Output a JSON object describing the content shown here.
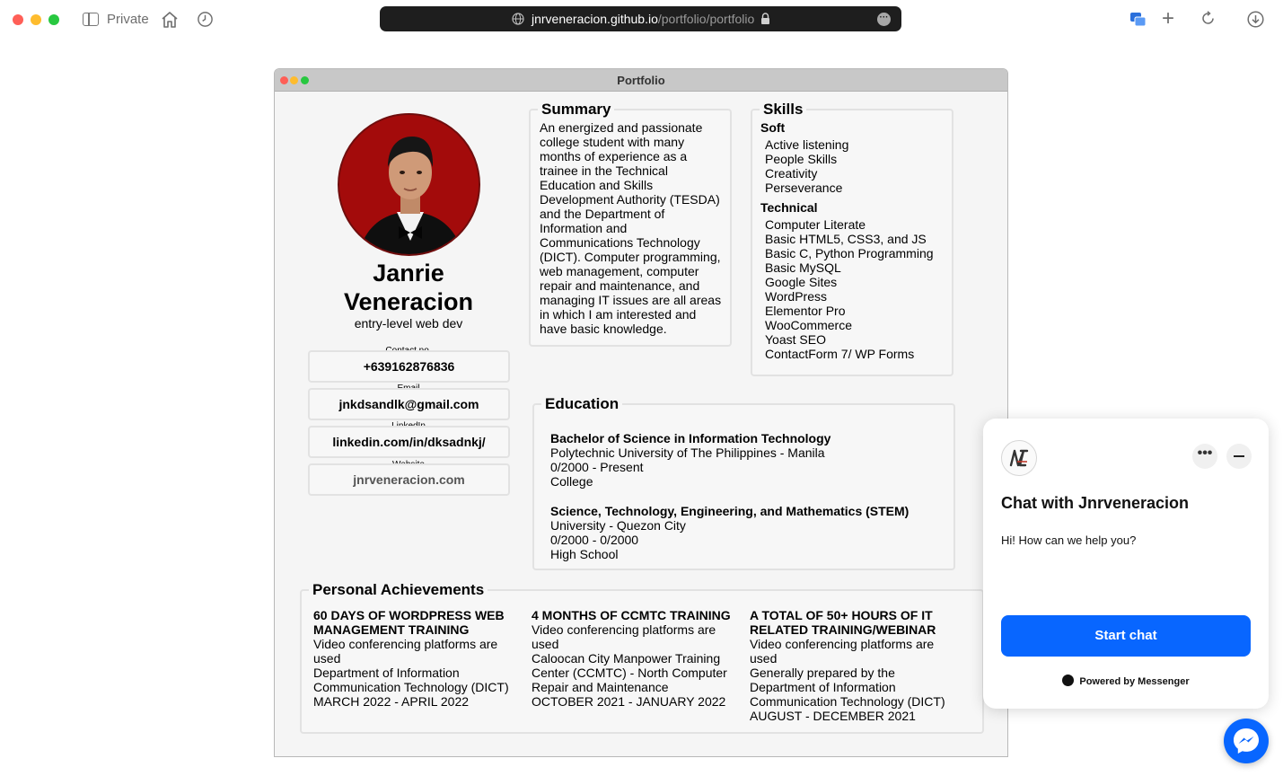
{
  "browser": {
    "private_label": "Private",
    "url_host": "jnrveneracion.github.io",
    "url_path": "/portfolio/portfolio"
  },
  "window": {
    "title": "Portfolio"
  },
  "profile": {
    "name": "Janrie Veneracion",
    "role": "entry-level web dev",
    "contacts": [
      {
        "label": "Contact no.",
        "value": "+639162876836"
      },
      {
        "label": "Email",
        "value": "jnkdsandlk@gmail.com"
      },
      {
        "label": "LinkedIn",
        "value": "linkedin.com/in/dksadnkj/"
      },
      {
        "label": "Website",
        "value": "jnrveneracion.com"
      }
    ]
  },
  "summary": {
    "heading": "Summary",
    "text": "An energized and passionate college student with many months of experience as a trainee in the Technical Education and Skills Development Authority (TESDA) and the Department of Information and Communications Technology (DICT). Computer programming, web management, computer repair and maintenance, and managing IT issues are all areas in which I am interested and have basic knowledge."
  },
  "skills": {
    "heading": "Skills",
    "soft_heading": "Soft",
    "soft": [
      "Active listening",
      "People Skills",
      "Creativity",
      "Perseverance"
    ],
    "technical_heading": "Technical",
    "technical": [
      "Computer Literate",
      "Basic HTML5, CSS3, and JS",
      "Basic C, Python Programming",
      "Basic MySQL",
      "Google Sites",
      "WordPress",
      "Elementor Pro",
      "WooCommerce",
      "Yoast SEO",
      "ContactForm 7/ WP Forms"
    ]
  },
  "education": {
    "heading": "Education",
    "items": [
      {
        "degree": "Bachelor of Science in Information Technology",
        "school": "Polytechnic University of The Philippines - Manila",
        "dates": "0/2000 - Present",
        "level": "College"
      },
      {
        "degree": "Science, Technology, Engineering, and Mathematics (STEM)",
        "school": "University - Quezon City",
        "dates": "0/2000 - 0/2000",
        "level": "High School"
      }
    ]
  },
  "achievements": {
    "heading": "Personal Achievements",
    "items": [
      {
        "title": "60 days of WordPress Web Management Training",
        "line1": "Video conferencing platforms are used",
        "line2": "Department of Information Communication Technology (DICT)",
        "dates": "MARCH 2022 - APRIL 2022"
      },
      {
        "title": "4 months of CCMTC Training",
        "line1": "Video conferencing platforms are used",
        "line2": "Caloocan City Manpower Training Center (CCMTC) - North Computer Repair and Maintenance",
        "dates": "OCTOBER 2021 - JANUARY 2022"
      },
      {
        "title": "A total of 50+ hours of IT related training/webinar",
        "line1": "Video conferencing platforms are used",
        "line2": "Generally prepared by the Department of Information Communication Technology (DICT)",
        "dates": "AUGUST - DECEMBER 2021"
      }
    ]
  },
  "chat": {
    "more_label": "•••",
    "title": "Chat with Jnrveneracion",
    "greeting": "Hi! How can we help you?",
    "button": "Start chat",
    "powered": "Powered by Messenger"
  },
  "colors": {
    "messenger_blue": "#0866ff",
    "avatar_bg": "#9e0a0a"
  }
}
